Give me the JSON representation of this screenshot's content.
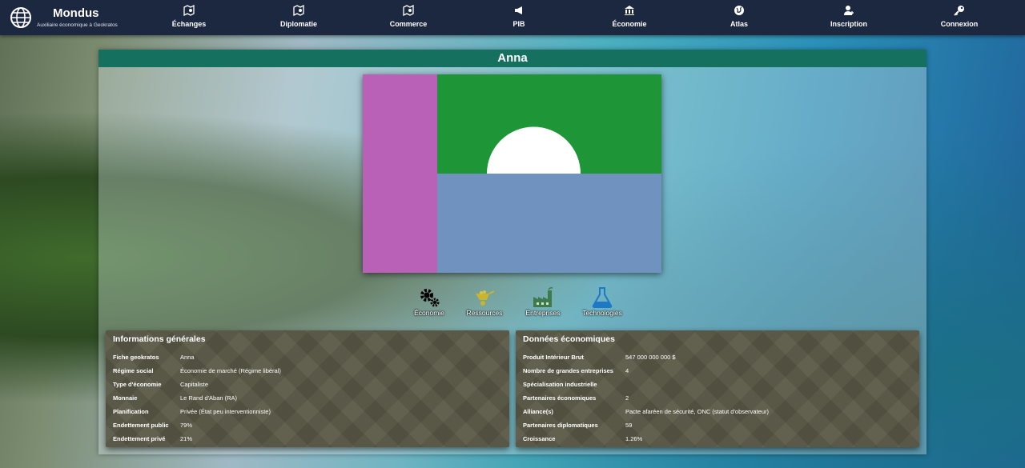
{
  "brand": {
    "name": "Mondus",
    "subtitle": "Auxiliaire économique à Geokratos",
    "icon": "globe-icon"
  },
  "nav": [
    {
      "label": "Échanges",
      "icon": "map-exchange-icon"
    },
    {
      "label": "Diplomatie",
      "icon": "map-diplomacy-icon"
    },
    {
      "label": "Commerce",
      "icon": "map-commerce-icon"
    },
    {
      "label": "PIB",
      "icon": "megaphone-icon"
    },
    {
      "label": "Économie",
      "icon": "bank-icon"
    },
    {
      "label": "Atlas",
      "icon": "globe-icon"
    },
    {
      "label": "Inscription",
      "icon": "user-add-icon"
    },
    {
      "label": "Connexion",
      "icon": "key-icon"
    }
  ],
  "country": {
    "name": "Anna"
  },
  "flag_colors": {
    "hoist": "#b861b6",
    "top": "#1e9638",
    "bottom": "#6f92bf",
    "sun": "#ffffff"
  },
  "tabs": [
    {
      "label": "Économie",
      "icon": "gears-icon",
      "color": "#000000"
    },
    {
      "label": "Ressources",
      "icon": "wheelbarrow-icon",
      "color": "#c9b42a"
    },
    {
      "label": "Entreprises",
      "icon": "factory-icon",
      "color": "#3f7a4d"
    },
    {
      "label": "Technologies",
      "icon": "flask-icon",
      "color": "#1e78c8"
    }
  ],
  "general": {
    "title": "Informations générales",
    "rows": [
      {
        "k": "Fiche geokratos",
        "v": "Anna"
      },
      {
        "k": "Régime social",
        "v": "Économie de marché (Régime libéral)"
      },
      {
        "k": "Type d'économie",
        "v": "Capitaliste"
      },
      {
        "k": "Monnaie",
        "v": "Le Rand d'Aban (RA)"
      },
      {
        "k": "Planification",
        "v": "Privée (État peu interventionniste)"
      },
      {
        "k": "Endettement public",
        "v": "79%"
      },
      {
        "k": "Endettement privé",
        "v": "21%"
      }
    ]
  },
  "economic": {
    "title": "Données économiques",
    "rows": [
      {
        "k": "Produit Intérieur Brut",
        "v": "547 000 000 000 $"
      },
      {
        "k": "Nombre de grandes entreprises",
        "v": "4"
      },
      {
        "k": "Spécialisation industrielle",
        "v": ""
      },
      {
        "k": "Partenaires économiques",
        "v": "2"
      },
      {
        "k": "Alliance(s)",
        "v": "Pacte afaréen de sécurité, ONC (statut d'observateur)"
      },
      {
        "k": "Partenaires diplomatiques",
        "v": "59"
      },
      {
        "k": "Croissance",
        "v": "1.26%"
      }
    ]
  }
}
